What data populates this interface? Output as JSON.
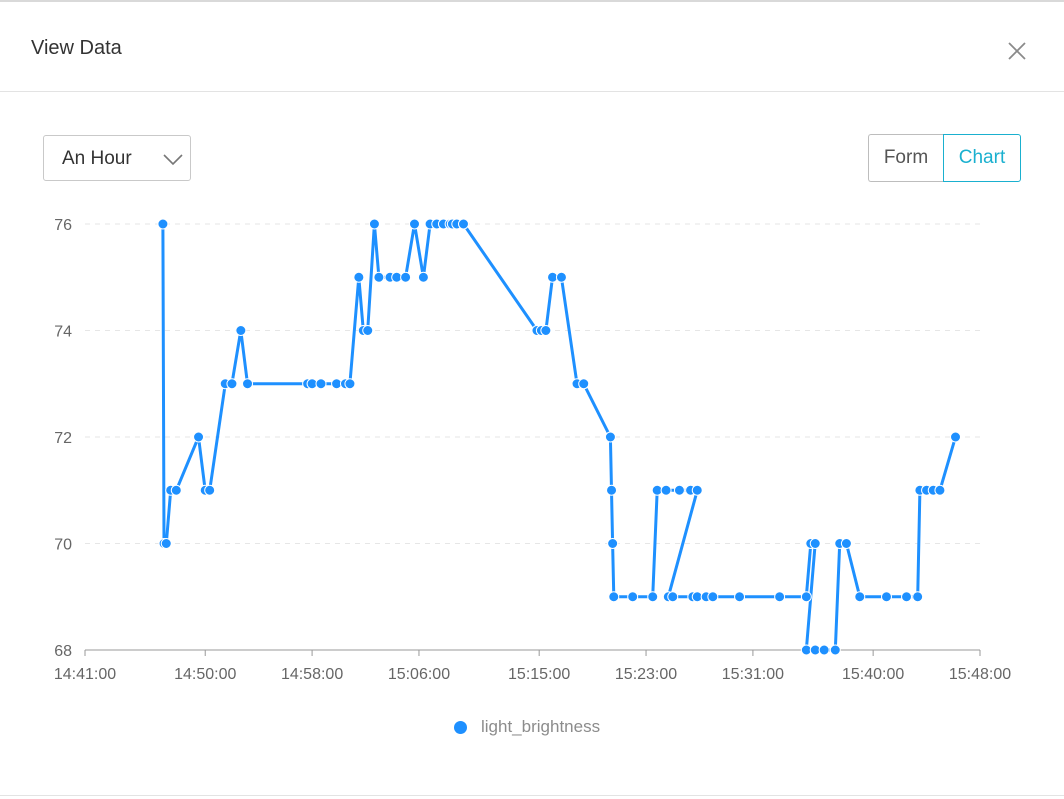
{
  "modal": {
    "title": "View Data",
    "close_icon": "close-icon"
  },
  "controls": {
    "range_select": {
      "value": "An Hour",
      "icon": "chevron-down-icon"
    },
    "view_toggle": {
      "form_label": "Form",
      "chart_label": "Chart",
      "active": "Chart"
    }
  },
  "colors": {
    "series": "#1e90ff",
    "accent": "#1ab0cf"
  },
  "chart_data": {
    "type": "line",
    "x_ticks": [
      "14:41:00",
      "14:50:00",
      "14:58:00",
      "15:06:00",
      "15:15:00",
      "15:23:00",
      "15:31:00",
      "15:40:00",
      "15:48:00"
    ],
    "y_ticks": [
      68,
      70,
      72,
      74,
      76
    ],
    "ylim": [
      68,
      76
    ],
    "xlim": [
      "14:41:00",
      "15:48:00"
    ],
    "grid": true,
    "legend_position": "bottom-center",
    "series": [
      {
        "name": "light_brightness",
        "points": [
          [
            "14:46:50",
            76
          ],
          [
            "14:46:55",
            70
          ],
          [
            "14:47:05",
            70
          ],
          [
            "14:47:25",
            71
          ],
          [
            "14:47:50",
            71
          ],
          [
            "14:49:30",
            72
          ],
          [
            "14:50:00",
            71
          ],
          [
            "14:50:20",
            71
          ],
          [
            "14:51:30",
            73
          ],
          [
            "14:52:00",
            73
          ],
          [
            "14:52:40",
            74
          ],
          [
            "14:53:10",
            73
          ],
          [
            "14:57:40",
            73
          ],
          [
            "14:58:00",
            73
          ],
          [
            "14:58:40",
            73
          ],
          [
            "14:59:50",
            73
          ],
          [
            "15:00:30",
            73
          ],
          [
            "15:00:50",
            73
          ],
          [
            "15:01:30",
            75
          ],
          [
            "15:01:50",
            74
          ],
          [
            "15:02:10",
            74
          ],
          [
            "15:02:40",
            76
          ],
          [
            "15:03:00",
            75
          ],
          [
            "15:03:50",
            75
          ],
          [
            "15:04:20",
            75
          ],
          [
            "15:05:00",
            75
          ],
          [
            "15:05:40",
            76
          ],
          [
            "15:06:20",
            75
          ],
          [
            "15:06:50",
            76
          ],
          [
            "15:07:20",
            76
          ],
          [
            "15:07:50",
            76
          ],
          [
            "15:08:20",
            76
          ],
          [
            "15:08:30",
            76
          ],
          [
            "15:08:50",
            76
          ],
          [
            "15:09:20",
            76
          ],
          [
            "15:14:50",
            74
          ],
          [
            "15:15:10",
            74
          ],
          [
            "15:15:30",
            74
          ],
          [
            "15:16:00",
            75
          ],
          [
            "15:16:40",
            75
          ],
          [
            "15:17:50",
            73
          ],
          [
            "15:18:20",
            73
          ],
          [
            "15:20:20",
            72
          ],
          [
            "15:20:25",
            71
          ],
          [
            "15:20:30",
            70
          ],
          [
            "15:20:35",
            69
          ],
          [
            "15:22:00",
            69
          ],
          [
            "15:23:30",
            69
          ],
          [
            "15:23:50",
            71
          ],
          [
            "15:24:30",
            71
          ],
          [
            "15:25:30",
            71
          ],
          [
            "15:26:20",
            71
          ],
          [
            "15:26:50",
            71
          ],
          [
            "15:24:40",
            69
          ],
          [
            "15:25:00",
            69
          ],
          [
            "15:26:30",
            69
          ],
          [
            "15:26:50",
            69
          ],
          [
            "15:27:30",
            69
          ],
          [
            "15:28:00",
            69
          ],
          [
            "15:30:00",
            69
          ],
          [
            "15:33:00",
            69
          ],
          [
            "15:35:00",
            69
          ],
          [
            "15:35:20",
            70
          ],
          [
            "15:35:40",
            70
          ],
          [
            "15:35:00",
            68
          ],
          [
            "15:35:40",
            68
          ],
          [
            "15:36:20",
            68
          ],
          [
            "15:37:10",
            68
          ],
          [
            "15:37:30",
            70
          ],
          [
            "15:38:00",
            70
          ],
          [
            "15:39:00",
            69
          ],
          [
            "15:41:00",
            69
          ],
          [
            "15:42:30",
            69
          ],
          [
            "15:43:20",
            69
          ],
          [
            "15:43:30",
            71
          ],
          [
            "15:44:00",
            71
          ],
          [
            "15:44:30",
            71
          ],
          [
            "15:45:00",
            71
          ],
          [
            "15:46:10",
            72
          ]
        ]
      }
    ]
  }
}
